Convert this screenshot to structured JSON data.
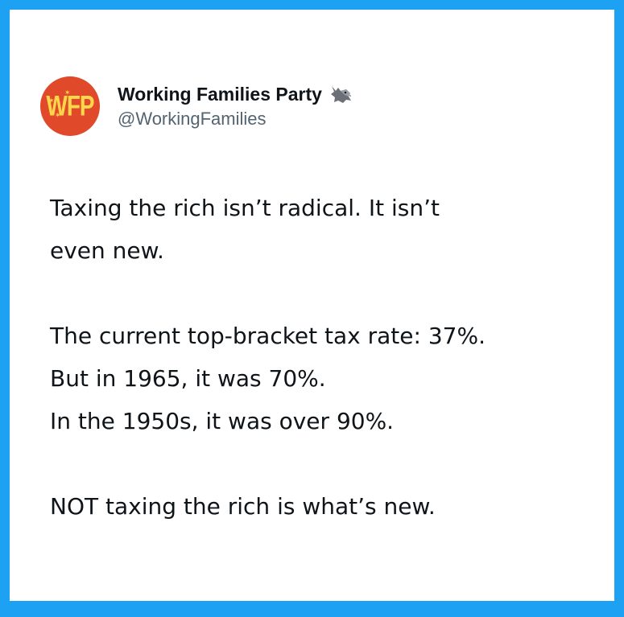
{
  "account": {
    "avatar_text": "WFP",
    "display_name": "Working Families Party",
    "handle": "@WorkingFamilies",
    "badge_icon": "wolf-emoji-icon"
  },
  "tweet": {
    "paragraph1": {
      "line1": "Taxing the rich isn’t radical. It isn’t",
      "line2": "even new."
    },
    "paragraph2": {
      "line1": "The current top-bracket tax rate: 37%.",
      "line2": "But in 1965, it was 70%.",
      "line3": "In the 1950s, it was over 90%."
    },
    "paragraph3": {
      "line1": "NOT taxing the rich is what’s new."
    }
  },
  "colors": {
    "border": "#1DA1F2",
    "avatar_bg": "#e04a2b",
    "avatar_text": "#ffd74a",
    "text": "#0f1419",
    "handle": "#536471"
  }
}
